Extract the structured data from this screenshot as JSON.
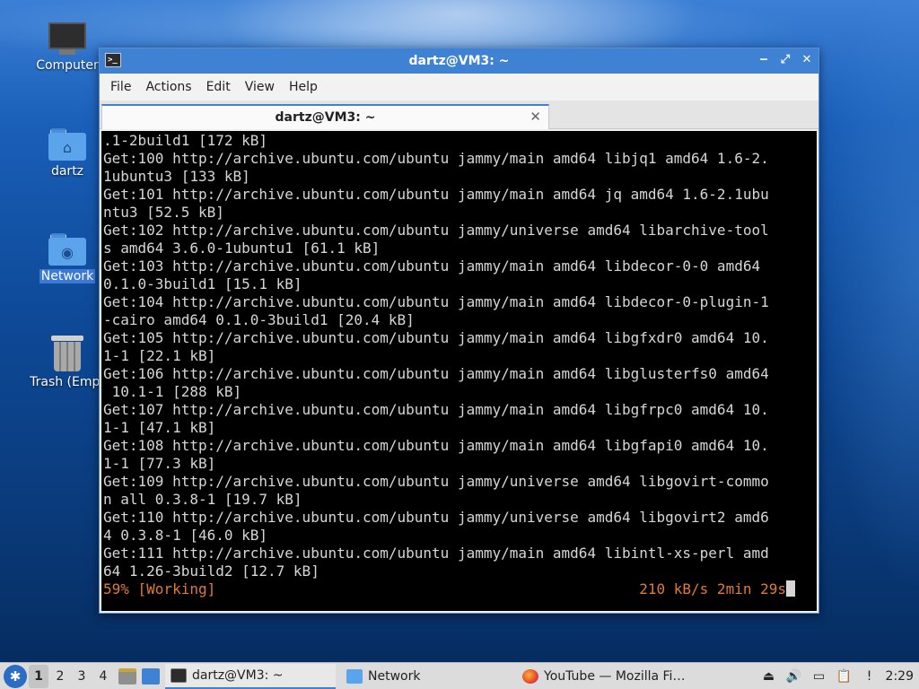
{
  "desktop": {
    "icons": [
      {
        "label": "Computer",
        "icon": "computer-icon"
      },
      {
        "label": "dartz",
        "icon": "home-folder-icon"
      },
      {
        "label": "Network",
        "icon": "network-folder-icon"
      },
      {
        "label": "Trash (Empt",
        "icon": "trash-icon"
      }
    ]
  },
  "window": {
    "title": "dartz@VM3: ~",
    "menu": [
      "File",
      "Actions",
      "Edit",
      "View",
      "Help"
    ],
    "tab_label": "dartz@VM3: ~",
    "tab_close": "✕"
  },
  "terminal": {
    "lines": [
      ".1-2build1 [172 kB]",
      "Get:100 http://archive.ubuntu.com/ubuntu jammy/main amd64 libjq1 amd64 1.6-2.",
      "1ubuntu3 [133 kB]",
      "Get:101 http://archive.ubuntu.com/ubuntu jammy/main amd64 jq amd64 1.6-2.1ubu",
      "ntu3 [52.5 kB]",
      "Get:102 http://archive.ubuntu.com/ubuntu jammy/universe amd64 libarchive-tool",
      "s amd64 3.6.0-1ubuntu1 [61.1 kB]",
      "Get:103 http://archive.ubuntu.com/ubuntu jammy/main amd64 libdecor-0-0 amd64",
      "0.1.0-3build1 [15.1 kB]",
      "Get:104 http://archive.ubuntu.com/ubuntu jammy/main amd64 libdecor-0-plugin-1",
      "-cairo amd64 0.1.0-3build1 [20.4 kB]",
      "Get:105 http://archive.ubuntu.com/ubuntu jammy/main amd64 libgfxdr0 amd64 10.",
      "1-1 [22.1 kB]",
      "Get:106 http://archive.ubuntu.com/ubuntu jammy/main amd64 libglusterfs0 amd64",
      " 10.1-1 [288 kB]",
      "Get:107 http://archive.ubuntu.com/ubuntu jammy/main amd64 libgfrpc0 amd64 10.",
      "1-1 [47.1 kB]",
      "Get:108 http://archive.ubuntu.com/ubuntu jammy/main amd64 libgfapi0 amd64 10.",
      "1-1 [77.3 kB]",
      "Get:109 http://archive.ubuntu.com/ubuntu jammy/universe amd64 libgovirt-commo",
      "n all 0.3.8-1 [19.7 kB]",
      "Get:110 http://archive.ubuntu.com/ubuntu jammy/universe amd64 libgovirt2 amd6",
      "4 0.3.8-1 [46.0 kB]",
      "Get:111 http://archive.ubuntu.com/ubuntu jammy/main amd64 libintl-xs-perl amd",
      "64 1.26-3build2 [12.7 kB]"
    ],
    "status_left": "59% [Working]",
    "status_right": "210 kB/s 2min 29s"
  },
  "taskbar": {
    "workspaces": [
      "1",
      "2",
      "3",
      "4"
    ],
    "tasks": [
      {
        "label": "dartz@VM3: ~",
        "icon": "terminal-icon"
      },
      {
        "label": "Network",
        "icon": "folder-icon"
      },
      {
        "label": "YouTube — Mozilla Fi…",
        "icon": "firefox-icon"
      }
    ],
    "clock": "2:29"
  }
}
